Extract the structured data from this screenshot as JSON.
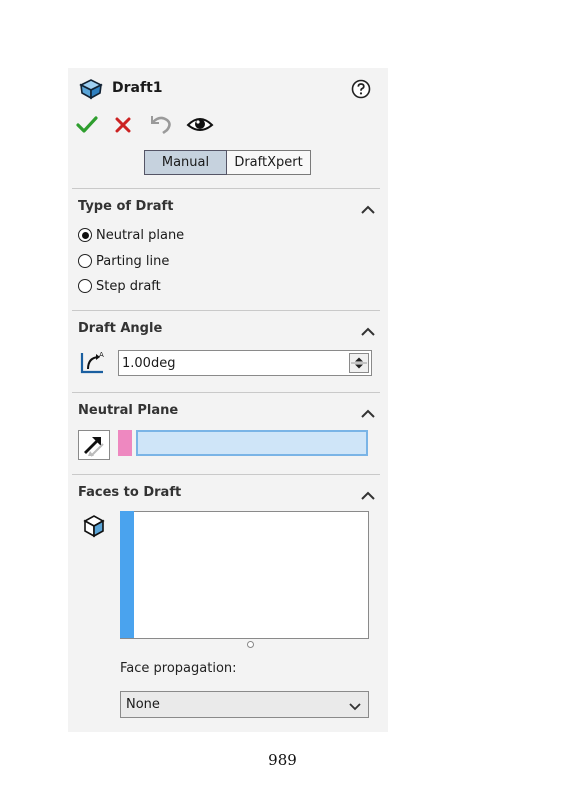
{
  "header": {
    "title": "Draft1",
    "icons": [
      "draft-feature-icon",
      "help-icon",
      "ok-check-icon",
      "cancel-x-icon",
      "undo-icon",
      "preview-eye-icon"
    ]
  },
  "mode_tabs": [
    {
      "label": "Manual",
      "selected": true
    },
    {
      "label": "DraftXpert",
      "selected": false
    }
  ],
  "type_of_draft": {
    "title": "Type of Draft",
    "options": [
      {
        "label": "Neutral plane",
        "selected": true
      },
      {
        "label": "Parting line",
        "selected": false
      },
      {
        "label": "Step draft",
        "selected": false
      }
    ]
  },
  "draft_angle": {
    "title": "Draft Angle",
    "value": "1.00deg"
  },
  "neutral_plane": {
    "title": "Neutral Plane",
    "value": ""
  },
  "faces_to_draft": {
    "title": "Faces to Draft",
    "items": [],
    "face_propagation_label": "Face propagation:",
    "face_propagation_value": "None"
  },
  "page_number": "989",
  "colors": {
    "accent_blue": "#4aa3ee",
    "selection_pink": "#ee88c0",
    "selected_tab": "#c6d2de",
    "ok_green": "#2e9e2e",
    "cancel_red": "#cc2222"
  }
}
